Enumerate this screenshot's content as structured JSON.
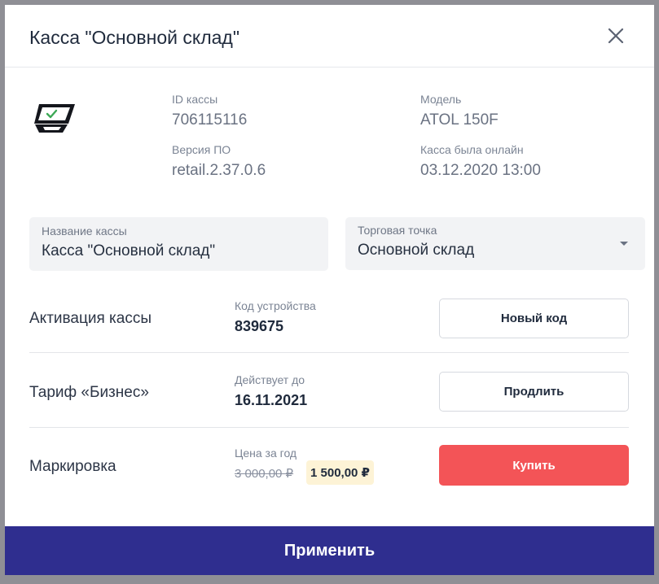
{
  "dialog": {
    "title": "Касса \"Основной склад\"",
    "apply_label": "Применить"
  },
  "info": {
    "id_label": "ID кассы",
    "id_value": "706115116",
    "model_label": "Модель",
    "model_value": "ATOL 150F",
    "version_label": "Версия ПО",
    "version_value": "retail.2.37.0.6",
    "online_label": "Касса была онлайн",
    "online_value": "03.12.2020 13:00"
  },
  "fields": {
    "name_label": "Название кассы",
    "name_value": "Касса \"Основной склад\"",
    "store_label": "Торговая точка",
    "store_value": "Основной склад"
  },
  "rows": {
    "activation": {
      "title": "Активация кассы",
      "label": "Код устройства",
      "value": "839675",
      "button": "Новый код"
    },
    "tariff": {
      "title": "Тариф «Бизнес»",
      "label": "Действует до",
      "value": "16.11.2021",
      "button": "Продлить"
    },
    "marking": {
      "title": "Маркировка",
      "label": "Цена за год",
      "old_price": "3 000,00 ₽",
      "new_price": "1 500,00 ₽",
      "button": "Купить"
    }
  },
  "colors": {
    "apply_button": "#2f2e8f",
    "buy_button": "#f35457",
    "price_badge": "#fdf3d6",
    "check_mark": "#3ca855"
  },
  "icons": {
    "close": "close-icon",
    "device": "cash-register-icon",
    "dropdown": "chevron-down-icon"
  }
}
